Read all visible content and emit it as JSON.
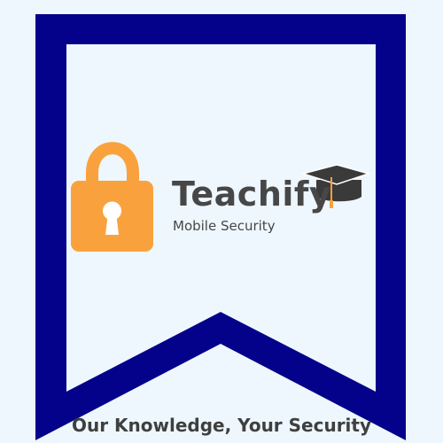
{
  "logo": {
    "brand_name": "Teachify",
    "subtitle": "Mobile Security",
    "tagline": "Our Knowledge, Your Security",
    "icons": [
      "lock-icon",
      "graduation-cap-icon"
    ]
  },
  "colors": {
    "background": "#eef7fd",
    "banner_border": "#04018a",
    "lock": "#f9a23d",
    "cap": "#3a3a3a",
    "tassel": "#f9a23d",
    "text": "#474747"
  }
}
